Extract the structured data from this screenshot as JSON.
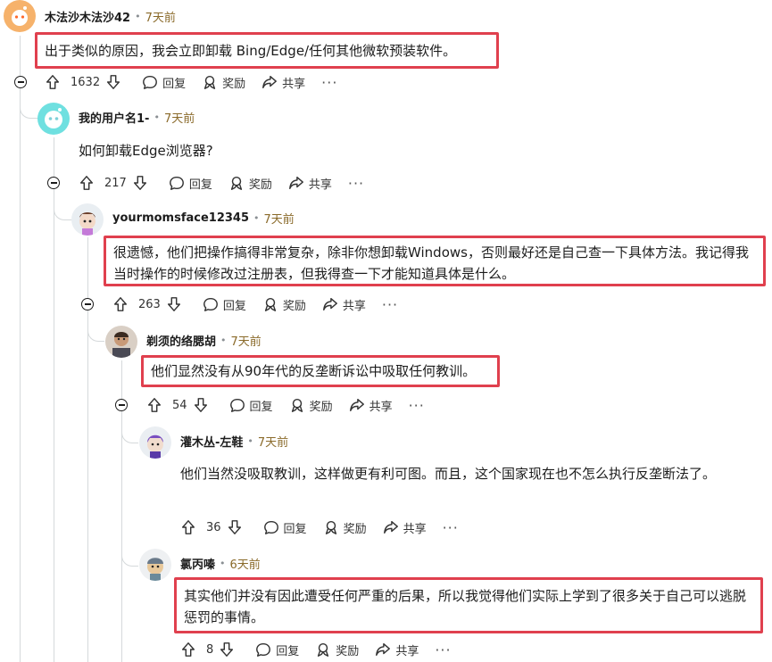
{
  "comments": [
    {
      "author": "木法沙木法沙42",
      "time": "7天前",
      "text": "出于类似的原因，我会立即卸载 Bing/Edge/任何其他微软预装软件。",
      "votes": "1632"
    },
    {
      "author": "我的用户名1-",
      "time": "7天前",
      "text": "如何卸载Edge浏览器?",
      "votes": "217"
    },
    {
      "author": "yourmomsface12345",
      "time": "7天前",
      "text": "很遗憾，他们把操作搞得非常复杂，除非你想卸载Windows，否则最好还是自己查一下具体方法。我记得我当时操作的时候修改过注册表，但我得查一下才能知道具体是什么。",
      "votes": "263"
    },
    {
      "author": "剃须的络腮胡",
      "time": "7天前",
      "text": "他们显然没有从90年代的反垄断诉讼中吸取任何教训。",
      "votes": "54"
    },
    {
      "author": "灌木丛-左鞋",
      "time": "7天前",
      "text": "他们当然没吸取教训，这样做更有利可图。而且，这个国家现在也不怎么执行反垄断法了。",
      "votes": "36"
    },
    {
      "author": "氯丙嗪",
      "time": "6天前",
      "text": "其实他们并没有因此遭受任何严重的后果，所以我觉得他们实际上学到了很多关于自己可以逃脱惩罚的事情。",
      "votes": "8"
    }
  ],
  "actions": {
    "reply": "回复",
    "award": "奖励",
    "share": "共享",
    "more": "···"
  },
  "separator": "•"
}
